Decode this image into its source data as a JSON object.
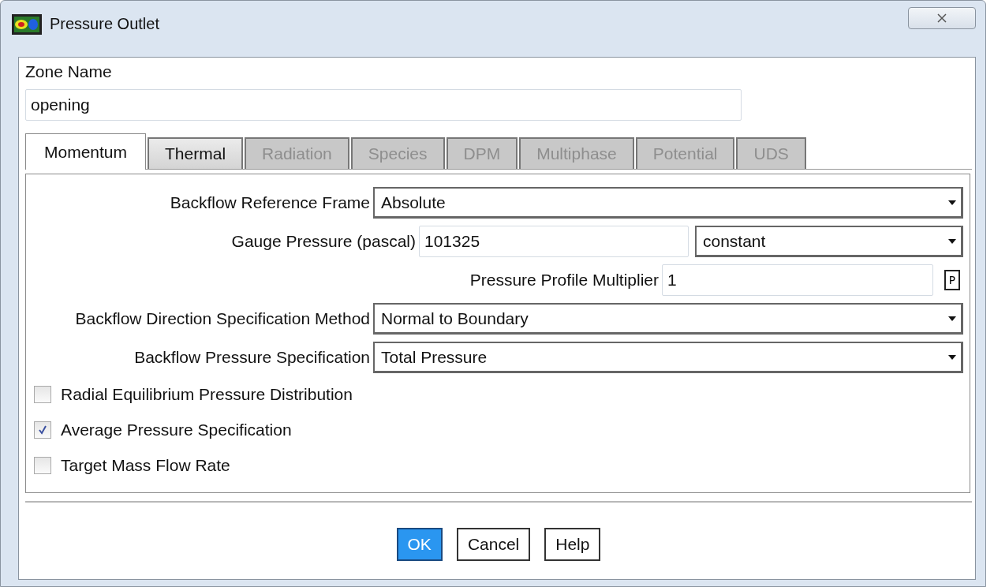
{
  "window": {
    "title": "Pressure Outlet"
  },
  "zone_name": {
    "label": "Zone Name",
    "value": "opening"
  },
  "tabs": [
    {
      "label": "Momentum",
      "selected": true,
      "disabled": false
    },
    {
      "label": "Thermal",
      "selected": false,
      "disabled": false
    },
    {
      "label": "Radiation",
      "selected": false,
      "disabled": true
    },
    {
      "label": "Species",
      "selected": false,
      "disabled": true
    },
    {
      "label": "DPM",
      "selected": false,
      "disabled": true
    },
    {
      "label": "Multiphase",
      "selected": false,
      "disabled": true
    },
    {
      "label": "Potential",
      "selected": false,
      "disabled": true
    },
    {
      "label": "UDS",
      "selected": false,
      "disabled": true
    }
  ],
  "fields": [
    {
      "kind": "dropdown",
      "label": "Backflow Reference Frame",
      "value": "Absolute"
    },
    {
      "kind": "input_dropdown",
      "label": "Gauge Pressure (pascal)",
      "value": "101325",
      "option": "constant"
    },
    {
      "kind": "input_button",
      "label": "Pressure Profile Multiplier",
      "value": "1",
      "button": "P"
    },
    {
      "kind": "dropdown",
      "label": "Backflow Direction Specification Method",
      "value": "Normal to Boundary"
    },
    {
      "kind": "dropdown",
      "label": "Backflow Pressure Specification",
      "value": "Total Pressure"
    }
  ],
  "checkboxes": [
    {
      "label": "Radial Equilibrium Pressure Distribution",
      "checked": false
    },
    {
      "label": "Average Pressure Specification",
      "checked": true
    },
    {
      "label": "Target Mass Flow Rate",
      "checked": false
    }
  ],
  "buttons": [
    {
      "label": "OK",
      "selected": true
    },
    {
      "label": "Cancel",
      "selected": false
    },
    {
      "label": "Help",
      "selected": false
    }
  ]
}
